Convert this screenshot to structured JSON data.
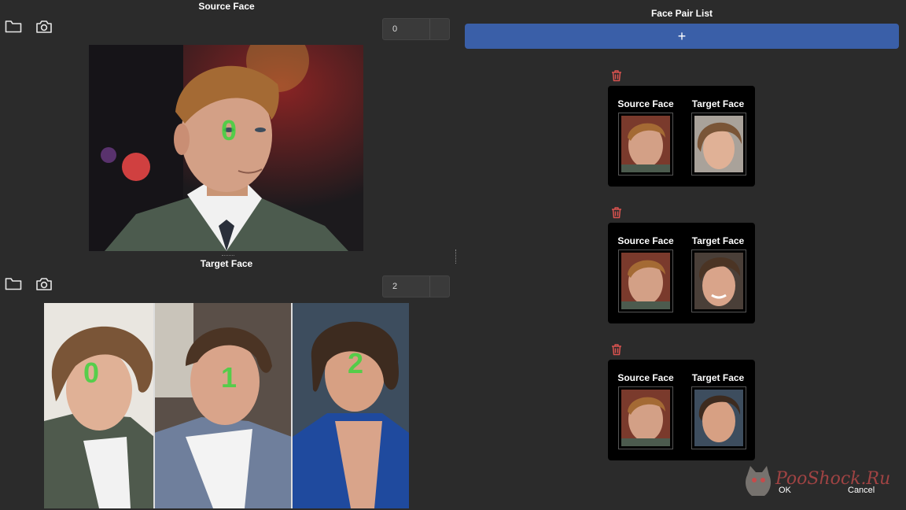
{
  "source": {
    "title": "Source Face",
    "face_index": "0",
    "face_number_label": "0"
  },
  "target": {
    "title": "Target Face",
    "face_index": "2",
    "face_number_labels": [
      "0",
      "1",
      "2"
    ]
  },
  "pairs": {
    "title": "Face Pair List",
    "add_label": "+",
    "items": [
      {
        "source_label": "Source Face",
        "target_label": "Target Face"
      },
      {
        "source_label": "Source Face",
        "target_label": "Target Face"
      },
      {
        "source_label": "Source Face",
        "target_label": "Target Face"
      }
    ]
  },
  "dialog": {
    "ok_label": "OK",
    "cancel_label": "Cancel"
  },
  "watermark": "PooShock.Ru",
  "icons": {
    "folder": "folder-icon",
    "camera": "camera-icon",
    "trash": "trash-icon"
  },
  "colors": {
    "background": "#2b2b2b",
    "accent": "#3a5fa8",
    "face_number": "#3fd43f",
    "trash": "#d9534f"
  }
}
